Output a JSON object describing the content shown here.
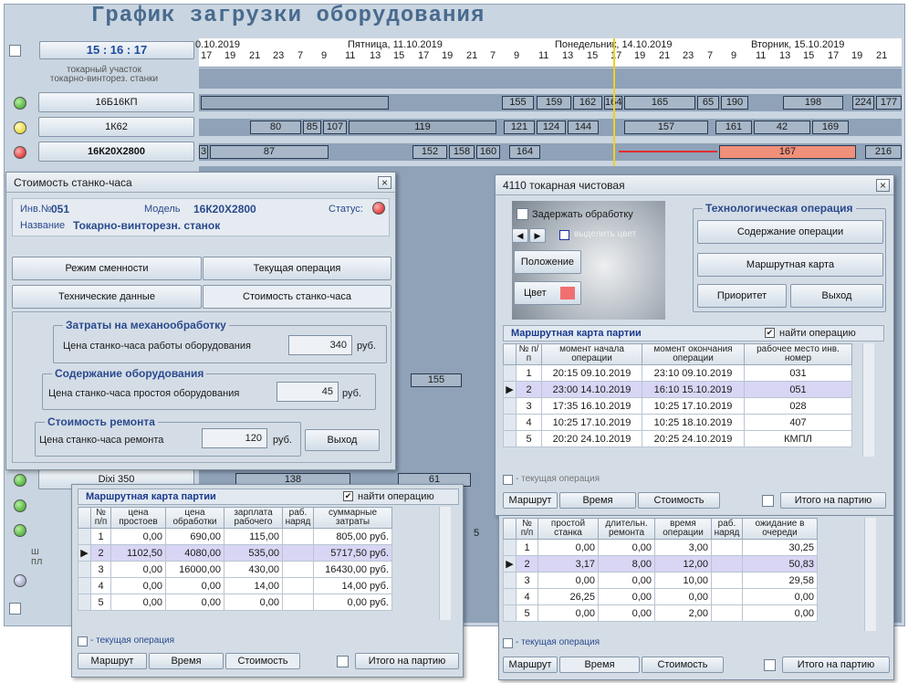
{
  "app": {
    "title": "График загрузки оборудования",
    "clock": "15 : 16 : 17",
    "section_line1": "токарный участок",
    "section_line2": "токарно-винторез. станки"
  },
  "timeline": {
    "days": [
      "0.10.2019",
      "Пятница, 11.10.2019",
      "Понедельник, 14.10.2019",
      "Вторник, 15.10.2019"
    ],
    "hours": [
      "17",
      "19",
      "21",
      "23",
      "7",
      "9",
      "11",
      "13",
      "15",
      "17",
      "19",
      "21",
      "7",
      "9",
      "11",
      "13",
      "15",
      "17",
      "19",
      "21",
      "23",
      "7",
      "9",
      "11",
      "13",
      "15",
      "17",
      "19",
      "21"
    ]
  },
  "machines": [
    {
      "name": "16Б16КП",
      "status": "green",
      "bars": [
        "155",
        "159",
        "162",
        "164",
        "165",
        "65",
        "190",
        "198",
        "224",
        "177"
      ]
    },
    {
      "name": "1К62",
      "status": "yellow",
      "bars": [
        "80",
        "85",
        "107",
        "119",
        "121",
        "124",
        "144",
        "157",
        "161",
        "42",
        "169"
      ]
    },
    {
      "name": "16К20Х2800",
      "status": "red",
      "bars": [
        "3",
        "87",
        "152",
        "158",
        "160",
        "164",
        "167",
        "216"
      ]
    }
  ],
  "lower_rows": {
    "machine_name": "Dixi 350",
    "bar1": "138",
    "bar2": "61",
    "mid_bar": "155",
    "partial_label_1": "ш",
    "partial_label_2": "пл",
    "partial_digit": "5"
  },
  "cost_dialog": {
    "title": "Стоимость станко-часа",
    "inv_label": "Инв.№",
    "inv_value": "051",
    "model_label": "Модель",
    "model_value": "16К20Х2800",
    "status_label": "Статус:",
    "name_label": "Название",
    "name_value": "Токарно-винторезн. станок",
    "tabs": [
      "Режим сменности",
      "Текущая операция",
      "Технические данные",
      "Стоимость станко-часа"
    ],
    "group1": {
      "title": "Затраты на механообработку",
      "label": "Цена станко-часа работы оборудования",
      "value": "340",
      "unit": "руб."
    },
    "group2": {
      "title": "Содержание оборудования",
      "label": "Цена станко-часа простоя оборудования",
      "value": "45",
      "unit": "руб."
    },
    "group3": {
      "title": "Стоимость ремонта",
      "label": "Цена станко-часа ремонта",
      "value": "120",
      "unit": "руб."
    },
    "exit": "Выход"
  },
  "op_dialog": {
    "title": "4110 токарная чистовая",
    "delay": "Задержать обработку",
    "highlight": "выделить цвет",
    "position": "Положение",
    "color": "Цвет",
    "group_title": "Технологическая операция",
    "content": "Содержание операции",
    "route_card": "Маршрутная карта",
    "priority": "Приоритет",
    "exit": "Выход",
    "grid_title": "Маршрутная карта партии",
    "find_op": "найти операцию",
    "headers": [
      "№ п/п",
      "момент начала операции",
      "момент окончания операции",
      "рабочее место инв. номер"
    ],
    "rows": [
      [
        "20:15 09.10.2019",
        "23:10 09.10.2019",
        "031"
      ],
      [
        "23:00 14.10.2019",
        "16:10 15.10.2019",
        "051"
      ],
      [
        "17:35 16.10.2019",
        "10:25 17.10.2019",
        "028"
      ],
      [
        "10:25 17.10.2019",
        "10:25 18.10.2019",
        "407"
      ],
      [
        "20:20 24.10.2019",
        "20:25 24.10.2019",
        "КМПЛ"
      ]
    ],
    "current_op": "- текущая операция",
    "tabs": [
      "Маршрут",
      "Время",
      "Стоимость"
    ],
    "total": "Итого на партию"
  },
  "cost_grid": {
    "title": "Маршрутная карта партии",
    "find_op": "найти операцию",
    "headers": [
      "№ п/п",
      "цена простоев",
      "цена обработки",
      "зарплата рабочего",
      "раб. наряд",
      "суммарные затраты"
    ],
    "rows": [
      [
        "1",
        "0,00",
        "690,00",
        "115,00",
        "",
        "805,00 руб."
      ],
      [
        "2",
        "1102,50",
        "4080,00",
        "535,00",
        "",
        "5717,50 руб."
      ],
      [
        "3",
        "0,00",
        "16000,00",
        "430,00",
        "",
        "16430,00 руб."
      ],
      [
        "4",
        "0,00",
        "0,00",
        "14,00",
        "",
        "14,00 руб."
      ],
      [
        "5",
        "0,00",
        "0,00",
        "0,00",
        "",
        "0,00 руб."
      ]
    ],
    "current_op": "- текущая операция",
    "tabs": [
      "Маршрут",
      "Время",
      "Стоимость"
    ],
    "total": "Итого на партию"
  },
  "time_grid": {
    "headers": [
      "№ п/п",
      "простой станка",
      "длительн. ремонта",
      "время операции",
      "раб. наряд",
      "ожидание в очереди"
    ],
    "rows": [
      [
        "1",
        "0,00",
        "0,00",
        "3,00",
        "",
        "30,25"
      ],
      [
        "2",
        "3,17",
        "8,00",
        "12,00",
        "",
        "50,83"
      ],
      [
        "3",
        "0,00",
        "0,00",
        "10,00",
        "",
        "29,58"
      ],
      [
        "4",
        "26,25",
        "0,00",
        "0,00",
        "",
        "0,00"
      ],
      [
        "5",
        "0,00",
        "0,00",
        "2,00",
        "",
        "0,00"
      ]
    ],
    "current_op": "- текущая операция",
    "tabs": [
      "Маршрут",
      "Время",
      "Стоимость"
    ],
    "total": "Итого на партию"
  }
}
